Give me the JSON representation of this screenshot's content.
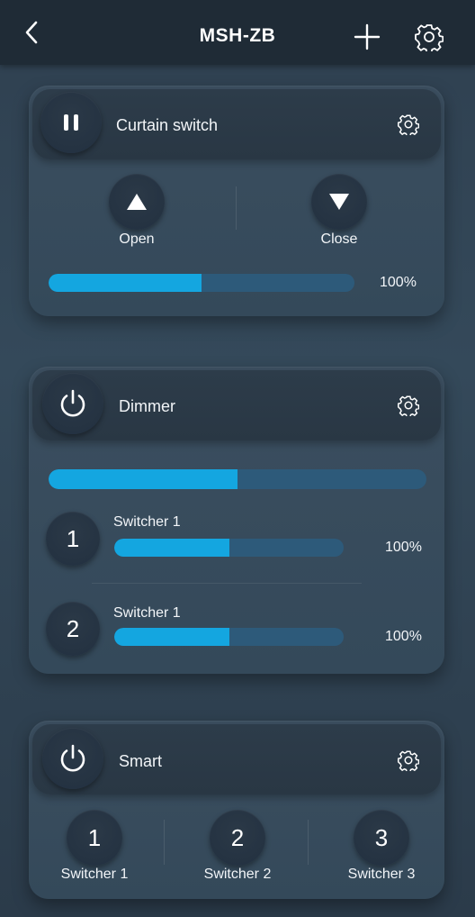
{
  "header": {
    "title": "MSH-ZB"
  },
  "curtain": {
    "label": "Curtain switch",
    "open_label": "Open",
    "close_label": "Close",
    "progress": 0.5,
    "percent_text": "100%"
  },
  "dimmer": {
    "label": "Dimmer",
    "master_progress": 0.5,
    "channels": [
      {
        "number": "1",
        "label": "Switcher 1",
        "progress": 0.5,
        "percent_text": "100%"
      },
      {
        "number": "2",
        "label": "Switcher 1",
        "progress": 0.5,
        "percent_text": "100%"
      }
    ]
  },
  "smart": {
    "label": "Smart",
    "switches": [
      {
        "number": "1",
        "label": "Switcher 1"
      },
      {
        "number": "2",
        "label": "Switcher 2"
      },
      {
        "number": "3",
        "label": "Switcher 3"
      }
    ]
  },
  "colors": {
    "accent": "#14a6e0",
    "track": "#2d5a7a",
    "topbar": "#1f2b36"
  }
}
